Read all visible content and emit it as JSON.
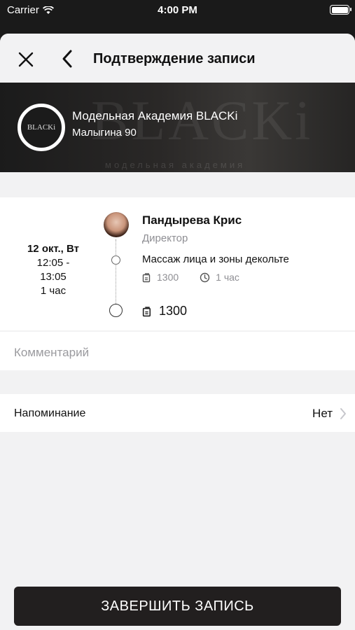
{
  "status_bar": {
    "carrier": "Carrier",
    "time": "4:00 PM"
  },
  "nav": {
    "title": "Подтверждение записи"
  },
  "salon": {
    "name": "Модельная Академия BLACKi",
    "address": "Малыгина 90",
    "logo_text": "BLACKi",
    "watermark": "BLACKi",
    "watermark_sub": "модельная академия"
  },
  "booking": {
    "date": "12 окт., Вт",
    "time_start": "12:05 -",
    "time_end": "13:05",
    "duration": "1 час",
    "master": {
      "name": "Пандырева Крис",
      "role": "Директор"
    },
    "service": {
      "name": "Массаж лица и зоны декольте",
      "price": "1300",
      "duration": "1 час"
    },
    "total": "1300"
  },
  "comment": {
    "placeholder": "Комментарий"
  },
  "reminder": {
    "label": "Напоминание",
    "value": "Нет"
  },
  "finish_button": {
    "label": "ЗАВЕРШИТЬ ЗАПИСЬ"
  }
}
